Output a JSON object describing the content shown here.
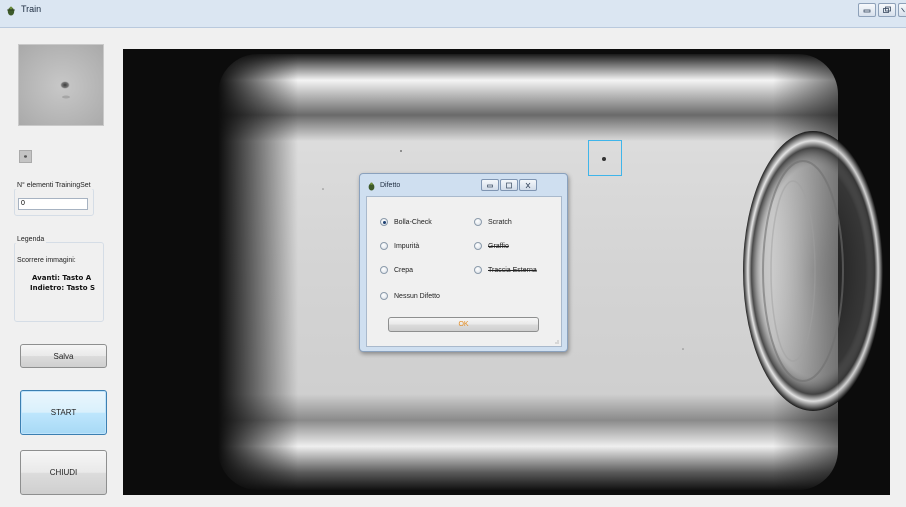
{
  "window": {
    "title": "Train",
    "icon": "app-icon"
  },
  "left_panel": {
    "trainingset": {
      "label": "N° elementi TrainingSet",
      "value": "0"
    },
    "legend": {
      "label": "Legenda",
      "scroll_label": "Scorrere immagini:",
      "forward": "Avanti: Tasto A",
      "back": "Indietro: Tasto S"
    },
    "buttons": {
      "save": "Salva",
      "start": "START",
      "close": "CHIUDI"
    }
  },
  "dialog": {
    "title": "Difetto",
    "options": [
      {
        "label": "Bolla-Check",
        "checked": true,
        "strikethrough": false
      },
      {
        "label": "Scratch",
        "checked": false,
        "strikethrough": false
      },
      {
        "label": "Impurità",
        "checked": false,
        "strikethrough": false
      },
      {
        "label": "Graffio",
        "checked": false,
        "strikethrough": true
      },
      {
        "label": "Crepa",
        "checked": false,
        "strikethrough": false
      },
      {
        "label": "Traccia Esterna",
        "checked": false,
        "strikethrough": true
      },
      {
        "label": "Nessun Difetto",
        "checked": false,
        "strikethrough": false
      }
    ],
    "ok_label": "OK"
  },
  "colors": {
    "selection_box": "#3fb5ea",
    "ok_text": "#e38a1e",
    "focus_border": "#3c7fb1"
  }
}
